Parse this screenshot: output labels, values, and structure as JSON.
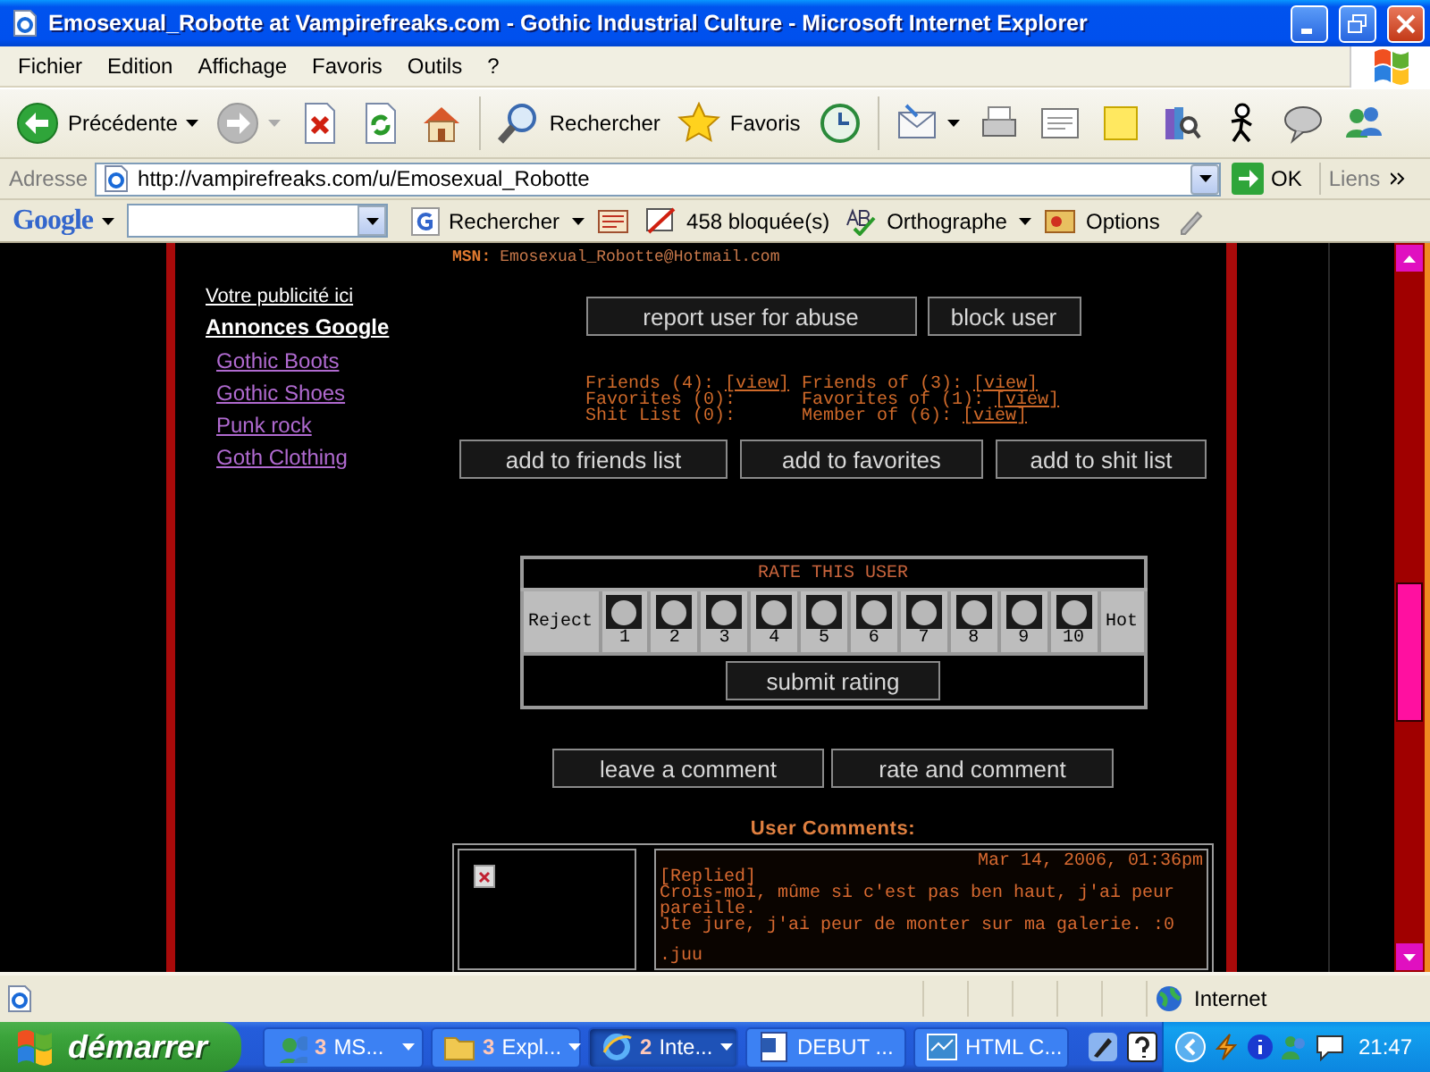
{
  "window": {
    "title": "Emosexual_Robotte at Vampirefreaks.com - Gothic Industrial Culture - Microsoft Internet Explorer"
  },
  "menu": [
    "Fichier",
    "Edition",
    "Affichage",
    "Favoris",
    "Outils",
    "?"
  ],
  "toolbar": {
    "back": "Précédente",
    "search": "Rechercher",
    "favorites": "Favoris"
  },
  "address_bar": {
    "label": "Adresse",
    "value": "http://vampirefreaks.com/u/Emosexual_Robotte",
    "go": "OK",
    "links": "Liens"
  },
  "google_bar": {
    "logo": "Google",
    "search": "Rechercher",
    "blocked": "458 bloquée(s)",
    "spelling": "Orthographe",
    "options": "Options"
  },
  "page": {
    "msn": {
      "label": "MSN:",
      "value": "Emosexual_Robotte@Hotmail.com"
    },
    "ads": {
      "title": "Votre publicité ici",
      "heading": "Annonces Google",
      "links": [
        "Gothic Boots",
        "Gothic Shoes",
        "Punk rock",
        "Goth Clothing"
      ]
    },
    "top_buttons": [
      "report user for abuse",
      "block user"
    ],
    "stats": [
      [
        {
          "label": "Friends (4):",
          "link": "[view]"
        },
        {
          "label": "Friends of (3):",
          "link": "[view]"
        }
      ],
      [
        {
          "label": "Favorites (0):"
        },
        {
          "label": "Favorites of (1):",
          "link": "[view]"
        }
      ],
      [
        {
          "label": "Shit List (0):"
        },
        {
          "label": "Member of (6):",
          "link": "[view]"
        }
      ]
    ],
    "list_buttons": [
      "add to friends list",
      "add to favorites",
      "add to shit list"
    ],
    "rating": {
      "title": "RATE THIS USER",
      "low": "Reject",
      "high": "Hot",
      "submit": "submit rating",
      "options": [
        {
          "label": "1",
          "selected": false
        },
        {
          "label": "2",
          "selected": false
        },
        {
          "label": "3",
          "selected": false
        },
        {
          "label": "4",
          "selected": false
        },
        {
          "label": "5",
          "selected": false
        },
        {
          "label": "6",
          "selected": false
        },
        {
          "label": "7",
          "selected": false
        },
        {
          "label": "8",
          "selected": false
        },
        {
          "label": "9",
          "selected": false
        },
        {
          "label": "10",
          "selected": false
        }
      ]
    },
    "comment_buttons": [
      "leave a comment",
      "rate and comment"
    ],
    "comments": {
      "title": "User Comments:",
      "items": [
        {
          "date": "Mar 14, 2006, 01:36pm",
          "tag": "[Replied]",
          "lines": [
            "Crois-moi, mûme si c'est pas ben haut, j'ai peur pareille.",
            "Jte jure, j'ai peur de monter sur ma galerie. :0"
          ],
          "signature": ".juu"
        }
      ]
    }
  },
  "status_bar": {
    "zone": "Internet"
  },
  "taskbar": {
    "start": "démarrer",
    "tasks": [
      {
        "kind": "people",
        "count": "3",
        "label": "MS...",
        "selected": false
      },
      {
        "kind": "folder",
        "count": "3",
        "label": "Expl...",
        "selected": false
      },
      {
        "kind": "browser",
        "count": "2",
        "label": "Inte...",
        "selected": true
      },
      {
        "kind": "document",
        "label": "DEBUT ...",
        "selected": false
      },
      {
        "kind": "html",
        "label": "HTML C...",
        "selected": false
      }
    ],
    "clock": "21:47"
  }
}
